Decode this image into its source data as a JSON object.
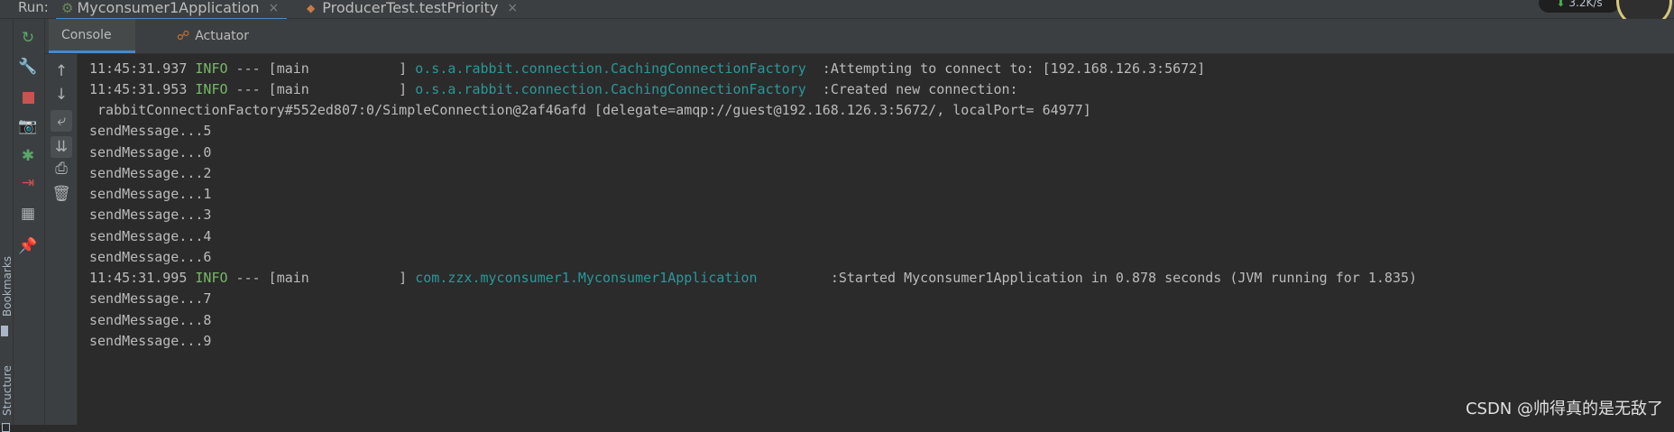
{
  "run_bar": {
    "label": "Run:",
    "tabs": [
      {
        "label": "Myconsumer1Application",
        "close": "×"
      },
      {
        "label": "ProducerTest.testPriority",
        "close": "×"
      }
    ],
    "speed": "3.2K/s"
  },
  "side_strip": {
    "bookmarks": "Bookmarks",
    "structure": "Structure"
  },
  "console_tabs": {
    "console": "Console",
    "actuator": "Actuator"
  },
  "tool_icons": {
    "col1": [
      "rerun-icon",
      "wrench-icon",
      "stop-icon",
      "camera-icon",
      "debug-icon",
      "exit-icon",
      "layout-icon",
      "pin-icon"
    ],
    "col2": [
      "arrow-up-icon",
      "arrow-down-icon",
      "soft-wrap-icon",
      "scroll-to-end-icon",
      "print-icon",
      "trash-icon"
    ]
  },
  "log": [
    {
      "ts": "11:45:31.937",
      "level": "INFO",
      "thread": " --- [main           ] ",
      "logger": "o.s.a.rabbit.connection.CachingConnectionFactory ",
      "msg": " :Attempting to connect to: [192.168.126.3:5672]"
    },
    {
      "ts": "11:45:31.953",
      "level": "INFO",
      "thread": " --- [main           ] ",
      "logger": "o.s.a.rabbit.connection.CachingConnectionFactory ",
      "msg": " :Created new connection:"
    },
    {
      "text": " rabbitConnectionFactory#552ed807:0/SimpleConnection@2af46afd [delegate=amqp://guest@192.168.126.3:5672/, localPort= 64977]"
    },
    {
      "text": "sendMessage...5"
    },
    {
      "text": "sendMessage...0"
    },
    {
      "text": "sendMessage...2"
    },
    {
      "text": "sendMessage...1"
    },
    {
      "text": "sendMessage...3"
    },
    {
      "text": "sendMessage...4"
    },
    {
      "text": "sendMessage...6"
    },
    {
      "ts": "11:45:31.995",
      "level": "INFO",
      "thread": " --- [main           ] ",
      "logger": "com.zzx.myconsumer1.Myconsumer1Application        ",
      "msg": " :Started Myconsumer1Application in 0.878 seconds (JVM running for 1.835)"
    },
    {
      "text": "sendMessage...7"
    },
    {
      "text": "sendMessage...8"
    },
    {
      "text": "sendMessage...9"
    }
  ],
  "watermark": "CSDN @帅得真的是无敌了",
  "colors": {
    "background": "#2b2b2b",
    "info": "#77b767",
    "logger": "#299999",
    "accent": "#4a88c7"
  }
}
